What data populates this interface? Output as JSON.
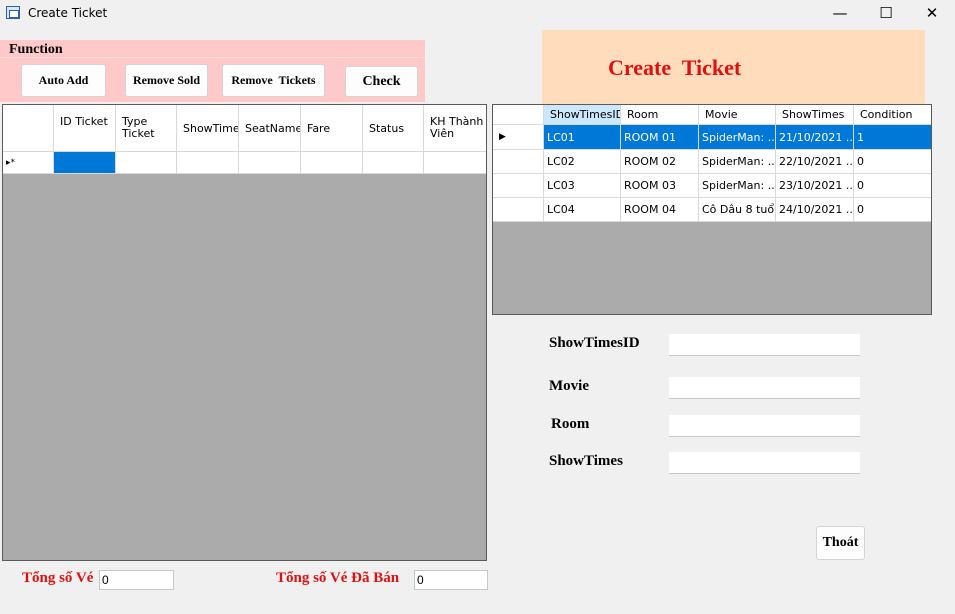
{
  "window": {
    "title": "Create Ticket",
    "minimize_glyph": "—",
    "maximize_glyph": "☐",
    "close_glyph": "✕"
  },
  "function_panel": {
    "label": "Function",
    "buttons": {
      "auto_add": "Auto Add",
      "remove_sold": "Remove Sold",
      "remove_tickets": "Remove  Tickets",
      "check": "Check"
    }
  },
  "ticket_grid": {
    "columns": [
      "ID Ticket",
      "Type Ticket",
      "ShowTimeI",
      "SeatName",
      "Fare",
      "Status",
      "KH Thành Viên"
    ],
    "new_row_marker": "▸*"
  },
  "banner": {
    "title": "Create  Ticket"
  },
  "showtimes_grid": {
    "columns": [
      "ShowTimesID",
      "Room",
      "Movie",
      "ShowTimes",
      "Condition"
    ],
    "current_row_marker": "▶",
    "rows": [
      [
        "LC01",
        "ROOM 01",
        "SpiderMan: ...",
        "21/10/2021 ...",
        "1"
      ],
      [
        "LC02",
        "ROOM 02",
        "SpiderMan: ...",
        "22/10/2021 ...",
        "0"
      ],
      [
        "LC03",
        "ROOM 03",
        "SpiderMan: ...",
        "23/10/2021 ...",
        "0"
      ],
      [
        "LC04",
        "ROOM 04",
        "Cô Dâu 8 tuổi",
        "24/10/2021 ...",
        "0"
      ]
    ]
  },
  "form": {
    "showtimes_id_label": "ShowTimesID",
    "showtimes_id_value": "",
    "movie_label": "Movie",
    "movie_value": "",
    "room_label": "Room",
    "room_value": "",
    "showtimes_label": "ShowTimes",
    "showtimes_value": ""
  },
  "exit_button": "Thoát",
  "totals": {
    "total_tickets_label": "Tổng số Vé",
    "total_tickets_value": "0",
    "sold_tickets_label": "Tổng số Vé Đã Bán",
    "sold_tickets_value": "0"
  },
  "colors": {
    "function_panel_bg": "#ffc9c9",
    "banner_bg": "#ffdcbb",
    "accent_red": "#e01010",
    "selection_blue": "#0078d7"
  }
}
